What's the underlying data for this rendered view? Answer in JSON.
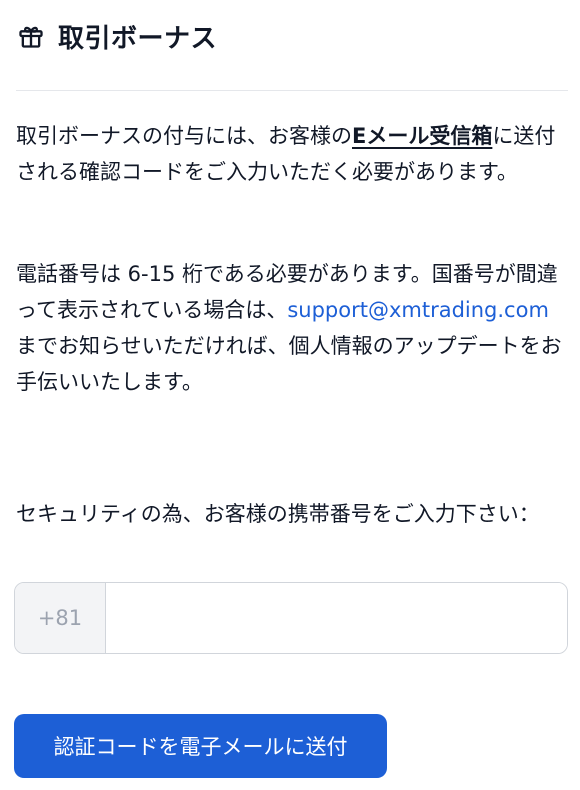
{
  "header": {
    "icon": "gift-icon",
    "title": "取引ボーナス"
  },
  "intro": {
    "before": "取引ボーナスの付与には、お客様の",
    "emphasis": "Eメール受信箱",
    "after": "に送付される確認コードをご入力いただく必要があります。"
  },
  "phone_note": {
    "before": "電話番号は 6-15 桁である必要があります。国番号が間違って表示されている場合は、",
    "email": "support@xmtrading.com",
    "after": " までお知らせいただければ、個人情報のアップデートをお手伝いいたします。"
  },
  "security_prompt": "セキュリティの為、お客様の携帯番号をご入力下さい：",
  "phone_field": {
    "country_code": "+81",
    "value": "",
    "placeholder": ""
  },
  "send_button": {
    "label": "認証コードを電子メールに送付",
    "color": "#1d5fd6"
  },
  "colors": {
    "link": "#1d5fd6",
    "text": "#111827",
    "divider": "#e5e7eb"
  }
}
